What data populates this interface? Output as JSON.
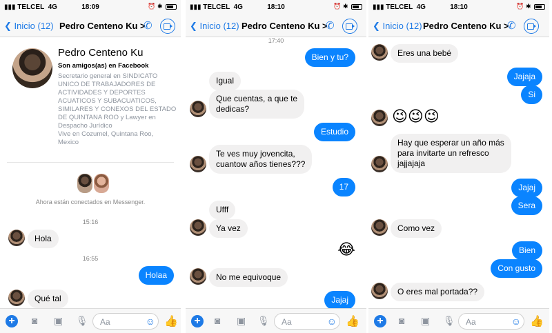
{
  "status": {
    "carrier": "TELCEL",
    "network": "4G"
  },
  "times": {
    "p1": "18:09",
    "p2": "18:10",
    "p3": "18:10"
  },
  "nav": {
    "back": "Inicio (12)",
    "title": "Pedro Centeno Ku",
    "chevron": ">"
  },
  "profile": {
    "name": "Pedro Centeno Ku",
    "friends": "Son amigos(as) en Facebook",
    "bio_lines": [
      "Secretario general en SINDICATO",
      "UNICO DE TRABAJADORES DE",
      "ACTIVIDADES Y DEPORTES",
      "ACUATICOS Y SUBACUATICOS,",
      "SIMILARES Y CONEXOS DEL ESTADO",
      "DE QUINTANA ROO y Lawyer en",
      "Despacho Jurídico",
      "Vive en Cozumel, Quintana Roo,",
      "Mexico"
    ],
    "connected": "Ahora están conectados en Messenger."
  },
  "p1": {
    "ts1": "15:16",
    "m1": "Hola",
    "ts2": "16:55",
    "m2": "Holaa",
    "m3": "Qué tal"
  },
  "p2": {
    "ts": "17:40",
    "m1": "Bien y tu?",
    "m2": "Igual",
    "m3a": "Que cuentas, a que te",
    "m3b": "dedicas?",
    "m4": "Estudio",
    "m5a": "Te ves muy jovencita,",
    "m5b": "cuantow años tienes???",
    "m6": "17",
    "m7": "Ufff",
    "m8": "Ya vez",
    "m9": "😂",
    "m10": "No me equivoque",
    "m11": "Jajaj"
  },
  "p3": {
    "m1": "Eres una bebé",
    "m2": "Jajaja",
    "m3": "Si",
    "m4": "😉😉😉",
    "m5a": "Hay que esperar un año más",
    "m5b": "para invitarte un refresco",
    "m5c": "jajjajaja",
    "m6": "Jajaj",
    "m7": "Sera",
    "m8": "Como vez",
    "m9": "Bien",
    "m10": "Con gusto",
    "m11": "O eres mal portada??"
  },
  "composer": {
    "placeholder": "Aa"
  },
  "icons": [
    "signal-icon",
    "back-chevron-icon",
    "phone-icon",
    "video-call-icon",
    "plus-icon",
    "camera-icon",
    "gallery-icon",
    "microphone-icon",
    "emoji-icon",
    "like-icon"
  ],
  "colors": {
    "accent": "#1e7ae6",
    "bubble_out": "#0a84ff",
    "bubble_in": "#f1f0f0"
  }
}
